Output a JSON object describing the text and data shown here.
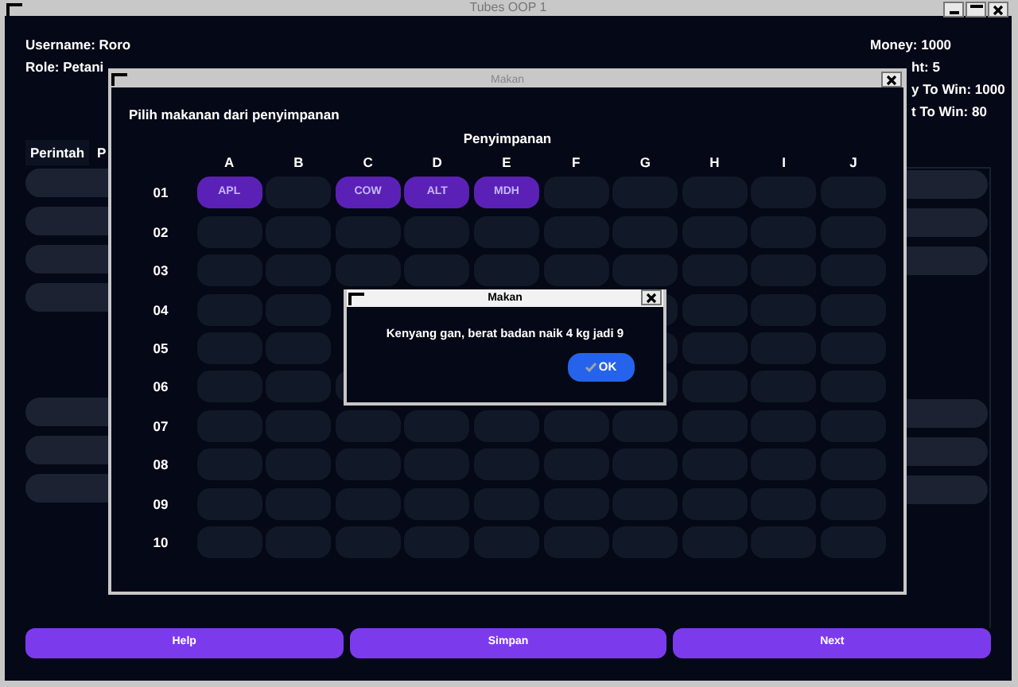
{
  "window": {
    "title": "Tubes OOP 1"
  },
  "player": {
    "username": "Username: Roro",
    "role": "Role: Petani"
  },
  "stats": [
    "Money: 1000",
    "ht: 5",
    "y To Win: 1000",
    "t To Win: 80"
  ],
  "tabs": [
    {
      "label": "Perintah",
      "selected": true
    },
    {
      "label": "P",
      "selected": false
    }
  ],
  "buttons": [
    "Help",
    "Simpan",
    "Next"
  ],
  "storage_dialog": {
    "title": "Makan",
    "prompt": "Pilih makanan dari penyimpanan",
    "grid_title": "Penyimpanan",
    "columns": [
      "A",
      "B",
      "C",
      "D",
      "E",
      "F",
      "G",
      "H",
      "I",
      "J"
    ],
    "rows": [
      {
        "label": "01",
        "cells": [
          "APL",
          null,
          "COW",
          "ALT",
          "MDH",
          null,
          null,
          null,
          null,
          null
        ]
      },
      {
        "label": "02"
      },
      {
        "label": "03"
      },
      {
        "label": "04"
      },
      {
        "label": "05"
      },
      {
        "label": "06"
      },
      {
        "label": "07"
      },
      {
        "label": "08"
      },
      {
        "label": "09"
      },
      {
        "label": "10"
      }
    ]
  },
  "message_dialog": {
    "title": "Makan",
    "message": "Kenyang gan, berat badan naik 4 kg jadi 9",
    "button": "OK"
  }
}
